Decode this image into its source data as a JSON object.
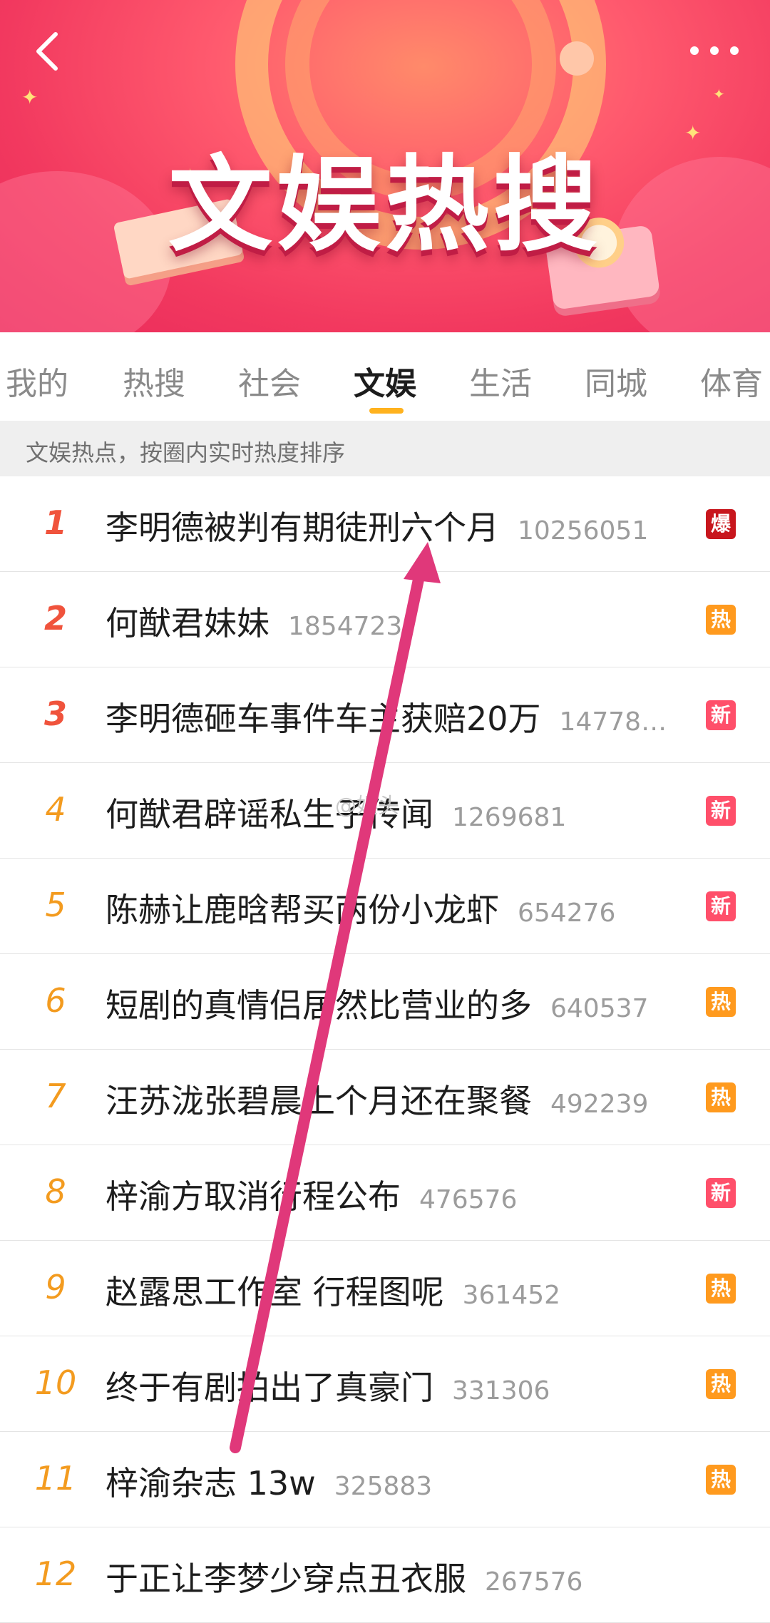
{
  "header": {
    "title": "文娱热搜",
    "colors": {
      "banner_primary": "#f2395f",
      "banner_glow": "#ffd27a",
      "accent": "#ffb21e"
    }
  },
  "tabs": [
    {
      "label": "我的"
    },
    {
      "label": "热搜"
    },
    {
      "label": "社会"
    },
    {
      "label": "文娱",
      "active": true
    },
    {
      "label": "生活"
    },
    {
      "label": "同城"
    },
    {
      "label": "体育"
    }
  ],
  "subtitle": "文娱热点，按圈内实时热度排序",
  "list": [
    {
      "rank": "1",
      "topic": "李明德被判有期徒刑六个月",
      "count": "10256051",
      "badge": "爆",
      "badge_color": "#c8161d"
    },
    {
      "rank": "2",
      "topic": "何猷君妹妹",
      "count": "1854723",
      "badge": "热",
      "badge_color": "#ff9a1e"
    },
    {
      "rank": "3",
      "topic": "李明德砸车事件车主获赔20万",
      "count": "14778…",
      "badge": "新",
      "badge_color": "#ff4f6a"
    },
    {
      "rank": "4",
      "topic": "何猷君辟谣私生子传闻",
      "count": "1269681",
      "badge": "新",
      "badge_color": "#ff4f6a"
    },
    {
      "rank": "5",
      "topic": "陈赫让鹿晗帮买两份小龙虾",
      "count": "654276",
      "badge": "新",
      "badge_color": "#ff4f6a"
    },
    {
      "rank": "6",
      "topic": "短剧的真情侣居然比营业的多",
      "count": "640537",
      "badge": "热",
      "badge_color": "#ff9a1e"
    },
    {
      "rank": "7",
      "topic": "汪苏泷张碧晨上个月还在聚餐",
      "count": "492239",
      "badge": "热",
      "badge_color": "#ff9a1e"
    },
    {
      "rank": "8",
      "topic": "梓渝方取消行程公布",
      "count": "476576",
      "badge": "新",
      "badge_color": "#ff4f6a"
    },
    {
      "rank": "9",
      "topic": "赵露思工作室 行程图呢",
      "count": "361452",
      "badge": "热",
      "badge_color": "#ff9a1e"
    },
    {
      "rank": "10",
      "topic": "终于有剧拍出了真豪门",
      "count": "331306",
      "badge": "热",
      "badge_color": "#ff9a1e"
    },
    {
      "rank": "11",
      "topic": "梓渝杂志 13w",
      "count": "325883",
      "badge": "热",
      "badge_color": "#ff9a1e"
    },
    {
      "rank": "12",
      "topic": "于正让李梦少穿点丑衣服",
      "count": "267576",
      "badge": "",
      "badge_color": ""
    }
  ],
  "watermark": "@娱头",
  "icons": {
    "back": "back-arrow-icon",
    "more": "more-dots-icon"
  },
  "annotation_arrow_color": "#e0387a"
}
